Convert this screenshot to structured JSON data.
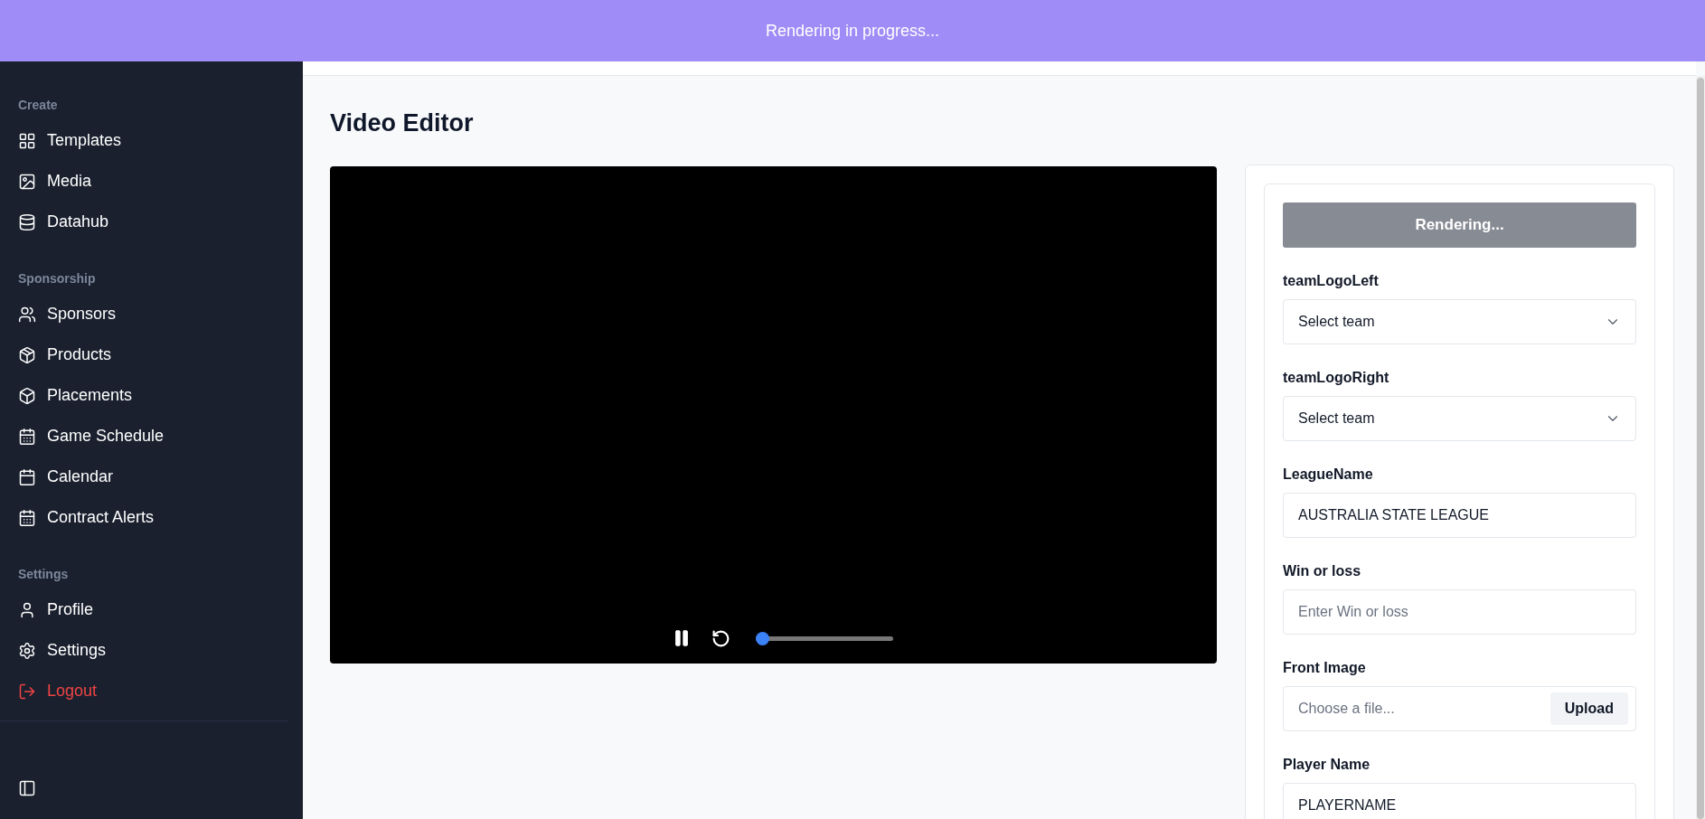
{
  "banner": {
    "text": "Rendering in progress..."
  },
  "sidebar": {
    "sections": [
      {
        "title": "Create",
        "items": [
          {
            "label": "Templates"
          },
          {
            "label": "Media"
          },
          {
            "label": "Datahub"
          }
        ]
      },
      {
        "title": "Sponsorship",
        "items": [
          {
            "label": "Sponsors"
          },
          {
            "label": "Products"
          },
          {
            "label": "Placements"
          },
          {
            "label": "Game Schedule"
          },
          {
            "label": "Calendar"
          },
          {
            "label": "Contract Alerts"
          }
        ]
      },
      {
        "title": "Settings",
        "items": [
          {
            "label": "Profile"
          },
          {
            "label": "Settings"
          },
          {
            "label": "Logout",
            "danger": true
          }
        ]
      }
    ]
  },
  "page": {
    "title": "Video Editor"
  },
  "player": {
    "playing": true,
    "level": 0
  },
  "form": {
    "render_button": {
      "label": "Rendering...",
      "disabled": true
    },
    "fields": [
      {
        "kind": "select",
        "label": "teamLogoLeft",
        "placeholder": "Select team"
      },
      {
        "kind": "select",
        "label": "teamLogoRight",
        "placeholder": "Select team"
      },
      {
        "kind": "text",
        "label": "LeagueName",
        "value": "AUSTRALIA STATE LEAGUE"
      },
      {
        "kind": "text",
        "label": "Win or loss",
        "placeholder": "Enter Win or loss"
      },
      {
        "kind": "file",
        "label": "Front Image",
        "placeholder": "Choose a file...",
        "button": "Upload"
      },
      {
        "kind": "text",
        "label": "Player Name",
        "value": "PLAYERNAME"
      }
    ]
  }
}
